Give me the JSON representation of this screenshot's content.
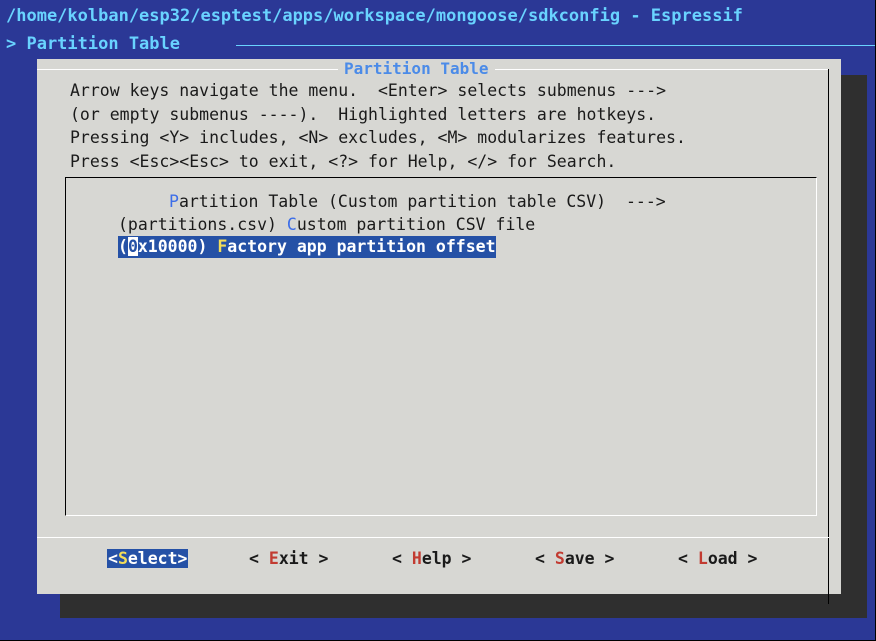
{
  "window": {
    "title": "/home/kolban/esp32/esptest/apps/workspace/mongoose/sdkconfig - Espressif",
    "breadcrumb": "> Partition Table"
  },
  "dialog": {
    "title": "Partition Table",
    "help_lines": [
      "Arrow keys navigate the menu.  <Enter> selects submenus --->",
      "(or empty submenus ----).  Highlighted letters are hotkeys.",
      "Pressing <Y> includes, <N> excludes, <M> modularizes features.",
      "Press <Esc><Esc> to exit, <?> for Help, </> for Search."
    ],
    "menu_items": [
      {
        "prefix": "",
        "hotkey": "P",
        "label": "artition Table (Custom partition table CSV)  --->",
        "selected": false
      },
      {
        "prefix": "(partitions.csv) ",
        "hotkey": "C",
        "label": "ustom partition CSV file",
        "selected": false
      },
      {
        "prefix_open": "(",
        "cursor_char": "0",
        "prefix_rest": "x10000) ",
        "hotkey": "F",
        "label": "actory app partition offset",
        "selected": true
      }
    ],
    "buttons": [
      {
        "open": "<",
        "hotkey": "S",
        "rest": "elect",
        "close": ">",
        "active": true
      },
      {
        "open": "< ",
        "hotkey": "E",
        "rest": "xit",
        "close": " >",
        "active": false
      },
      {
        "open": "< ",
        "hotkey": "H",
        "rest": "elp",
        "close": " >",
        "active": false
      },
      {
        "open": "< ",
        "hotkey": "S",
        "rest": "ave",
        "close": " >",
        "active": false
      },
      {
        "open": "< ",
        "hotkey": "L",
        "rest": "oad",
        "close": " >",
        "active": false
      }
    ]
  },
  "colors": {
    "background": "#2b3896",
    "title_text": "#69d3ff",
    "dialog_bg": "#d7d7d3",
    "highlight_bg": "#2551a6",
    "hotkey_menu": "#3d6ee8",
    "hotkey_button": "#c23b31",
    "hotkey_selected": "#f3dd59"
  }
}
